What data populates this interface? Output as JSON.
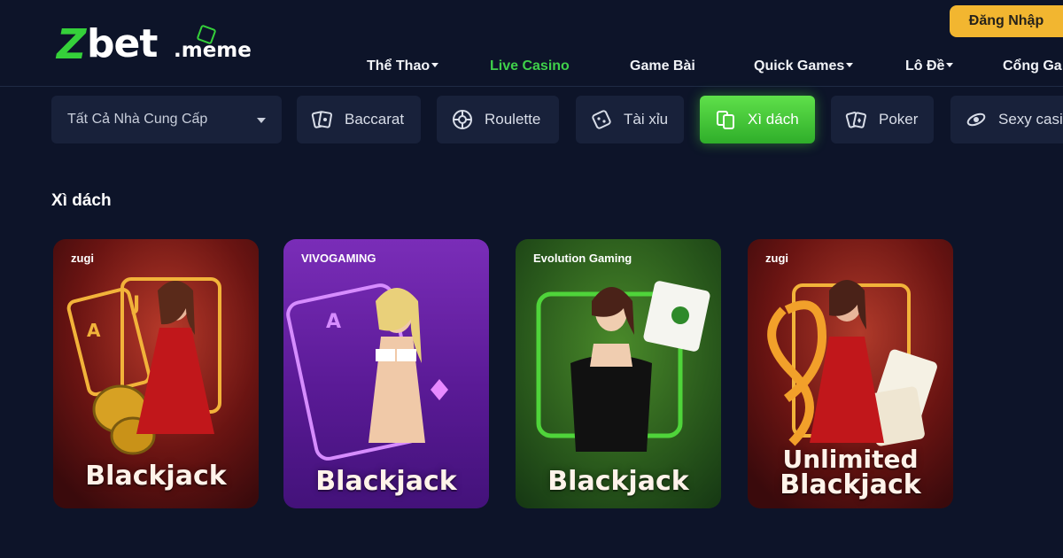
{
  "brand": {
    "logo_z": "Z",
    "logo_bet": "bet",
    "logo_tld": ".meme"
  },
  "header": {
    "login_label": "Đăng Nhập"
  },
  "nav": {
    "items": [
      {
        "label": "Thể Thao",
        "has_caret": true
      },
      {
        "label": "Live Casino",
        "active": true
      },
      {
        "label": "Game Bài"
      },
      {
        "label": "Quick Games",
        "has_caret": true
      },
      {
        "label": "Lô Đề",
        "has_caret": true
      },
      {
        "label": "Cổng Ga"
      }
    ]
  },
  "filters": {
    "provider_select": "Tất Cả Nhà Cung Cấp",
    "chips": [
      {
        "label": "Baccarat",
        "icon": "baccarat-icon"
      },
      {
        "label": "Roulette",
        "icon": "roulette-icon"
      },
      {
        "label": "Tài xỉu",
        "icon": "dice-icon"
      },
      {
        "label": "Xì dách",
        "icon": "cards-icon",
        "active": true
      },
      {
        "label": "Poker",
        "icon": "poker-icon"
      },
      {
        "label": "Sexy casi",
        "icon": "sexy-casino-icon"
      }
    ]
  },
  "section": {
    "title": "Xì dách"
  },
  "games": [
    {
      "provider": "zugi",
      "title_line1": "",
      "title_line2": "Blackjack",
      "theme": "red"
    },
    {
      "provider": "VIVOGAMING",
      "title_line1": "",
      "title_line2": "Blackjack",
      "theme": "purple"
    },
    {
      "provider": "Evolution Gaming",
      "title_line1": "",
      "title_line2": "Blackjack",
      "theme": "green"
    },
    {
      "provider": "zugi",
      "title_line1": "Unlimited",
      "title_line2": "Blackjack",
      "theme": "red"
    }
  ],
  "colors": {
    "background": "#0d1429",
    "accent_green": "#3fd04a",
    "login_yellow": "#f2b630",
    "chip_bg": "#18213a"
  }
}
